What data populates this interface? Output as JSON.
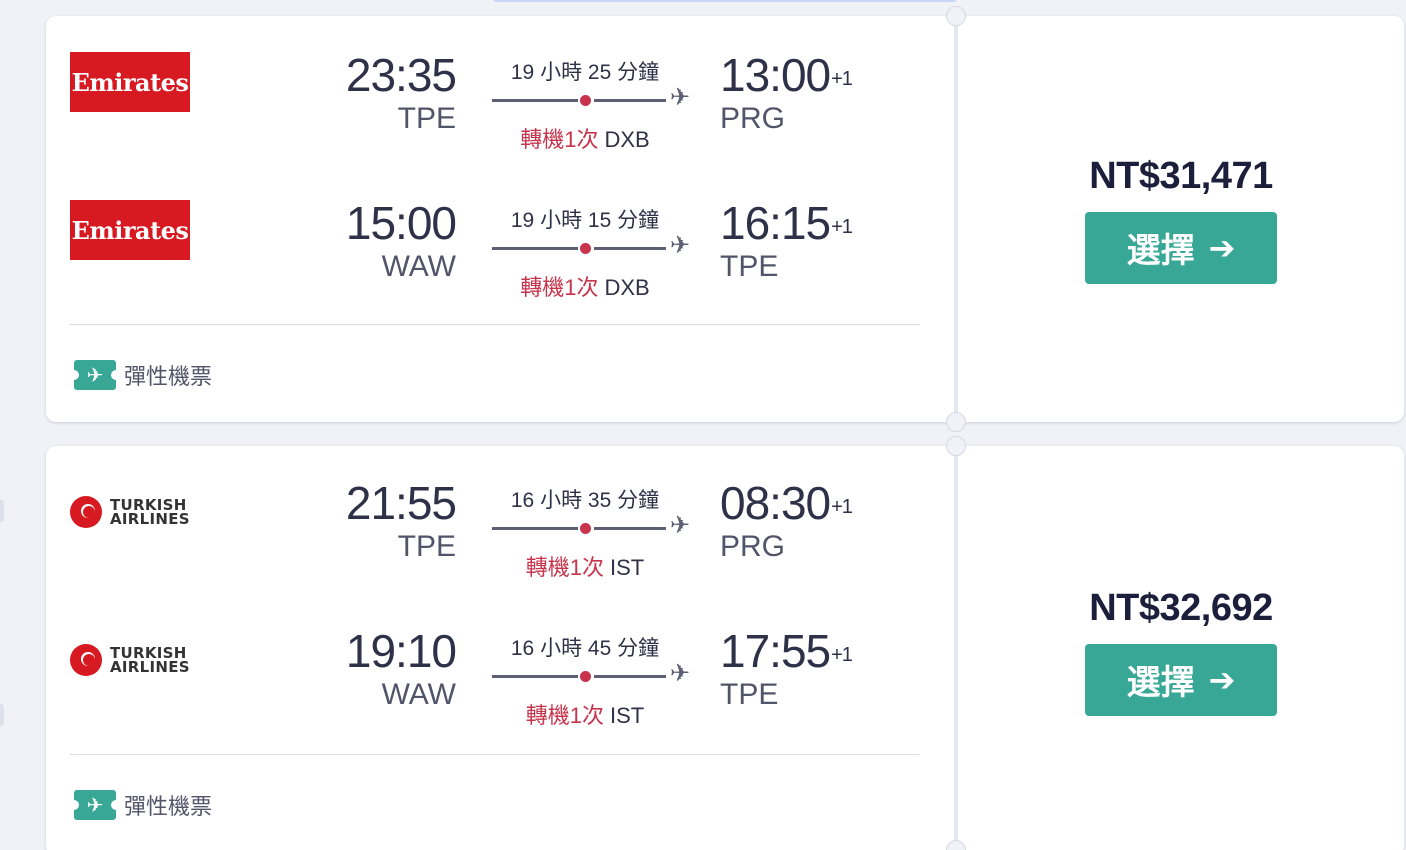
{
  "results": [
    {
      "price": "NT$31,471",
      "select_label": "選擇",
      "flex_label": "彈性機票",
      "legs": [
        {
          "airline": "Emirates",
          "dep_time": "23:35",
          "dep_code": "TPE",
          "duration": "19 小時 25 分鐘",
          "stops": "轉機1次",
          "via": "DXB",
          "arr_time": "13:00",
          "arr_offset": "+1",
          "arr_code": "PRG"
        },
        {
          "airline": "Emirates",
          "dep_time": "15:00",
          "dep_code": "WAW",
          "duration": "19 小時 15 分鐘",
          "stops": "轉機1次",
          "via": "DXB",
          "arr_time": "16:15",
          "arr_offset": "+1",
          "arr_code": "TPE"
        }
      ]
    },
    {
      "price": "NT$32,692",
      "select_label": "選擇",
      "flex_label": "彈性機票",
      "legs": [
        {
          "airline_line1": "TURKISH",
          "airline_line2": "AIRLINES",
          "dep_time": "21:55",
          "dep_code": "TPE",
          "duration": "16 小時 35 分鐘",
          "stops": "轉機1次",
          "via": "IST",
          "arr_time": "08:30",
          "arr_offset": "+1",
          "arr_code": "PRG"
        },
        {
          "airline_line1": "TURKISH",
          "airline_line2": "AIRLINES",
          "dep_time": "19:10",
          "dep_code": "WAW",
          "duration": "16 小時 45 分鐘",
          "stops": "轉機1次",
          "via": "IST",
          "arr_time": "17:55",
          "arr_offset": "+1",
          "arr_code": "TPE"
        }
      ]
    }
  ],
  "icons": {
    "flex": "plane-ticket-icon",
    "route_end": "airplane-icon",
    "select": "arrow-right-icon"
  },
  "colors": {
    "accent": "#38a795",
    "stop": "#c8344c",
    "emirates": "#d71921",
    "turkish": "#d71921"
  }
}
